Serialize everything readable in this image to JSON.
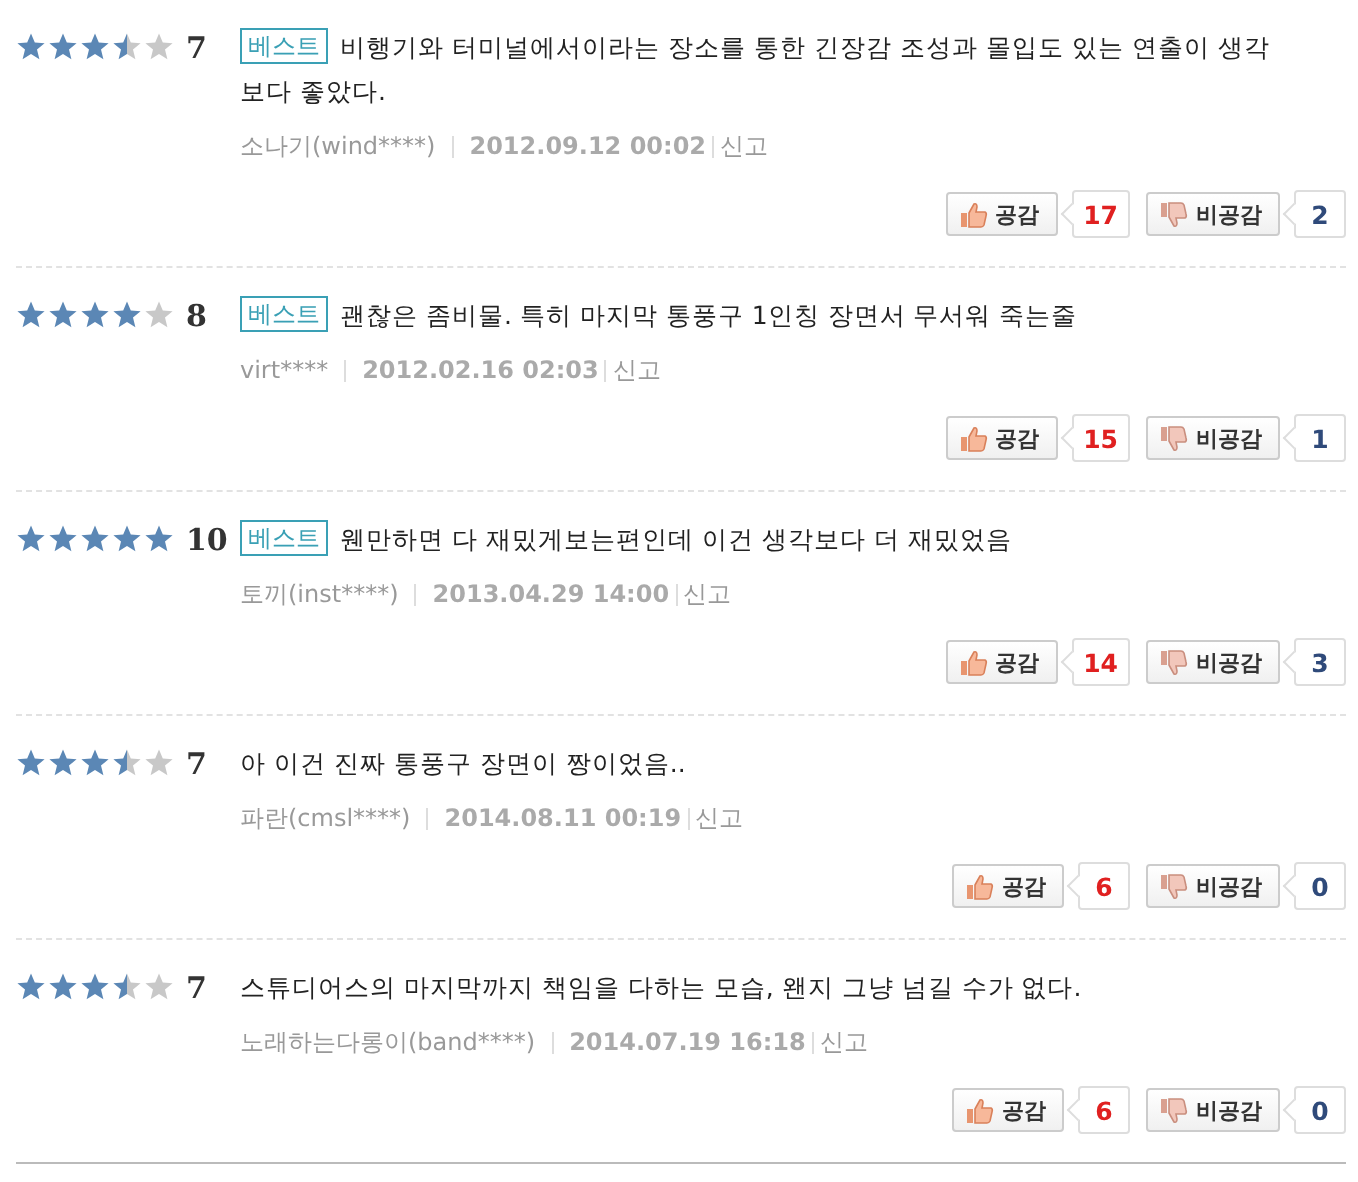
{
  "reviews": [
    {
      "stars": 3.5,
      "score": "7",
      "best": true,
      "best_label": "베스트",
      "text": "비행기와 터미널에서이라는 장소를 통한 긴장감 조성과 몰입도 있는 연출이 생각보다 좋았다.",
      "author": "소나기(wind****)",
      "date": "2012.09.12 00:02",
      "report": "신고",
      "like_label": "공감",
      "likes": "17",
      "dislike_label": "비공감",
      "dislikes": "2"
    },
    {
      "stars": 4,
      "score": "8",
      "best": true,
      "best_label": "베스트",
      "text": "괜찮은 좀비물. 특히 마지막 통풍구 1인칭 장면서 무서워 죽는줄",
      "author": "virt****",
      "date": "2012.02.16 02:03",
      "report": "신고",
      "like_label": "공감",
      "likes": "15",
      "dislike_label": "비공감",
      "dislikes": "1"
    },
    {
      "stars": 5,
      "score": "10",
      "best": true,
      "best_label": "베스트",
      "text": "웬만하면 다 재밌게보는편인데 이건 생각보다 더 재밌었음",
      "author": "토끼(inst****)",
      "date": "2013.04.29 14:00",
      "report": "신고",
      "like_label": "공감",
      "likes": "14",
      "dislike_label": "비공감",
      "dislikes": "3"
    },
    {
      "stars": 3.5,
      "score": "7",
      "best": false,
      "text": "아 이건 진짜 통풍구 장면이 짱이었음..",
      "author": "파란(cmsl****)",
      "date": "2014.08.11 00:19",
      "report": "신고",
      "like_label": "공감",
      "likes": "6",
      "dislike_label": "비공감",
      "dislikes": "0"
    },
    {
      "stars": 3.5,
      "score": "7",
      "best": false,
      "text": "스튜디어스의 마지막까지 책임을 다하는 모습, 왠지 그냥 넘길 수가 없다.",
      "author": "노래하는다롱이(band****)",
      "date": "2014.07.19 16:18",
      "report": "신고",
      "like_label": "공감",
      "likes": "6",
      "dislike_label": "비공감",
      "dislikes": "0"
    }
  ]
}
